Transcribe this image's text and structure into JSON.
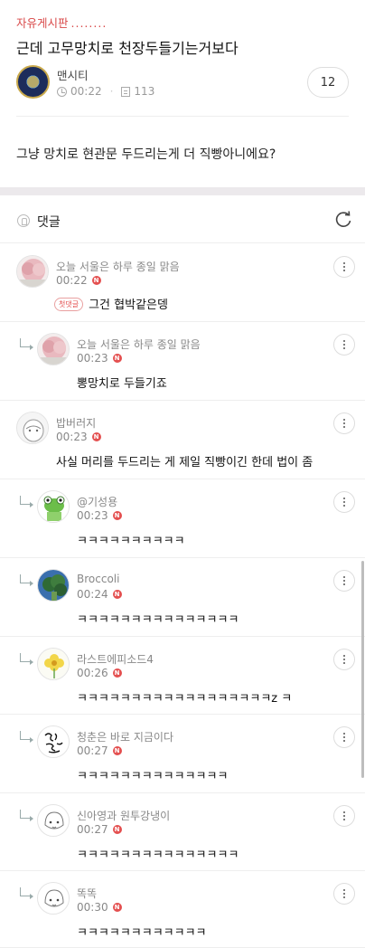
{
  "post": {
    "board": "자유게시판",
    "board_dots": "........",
    "title": "근데 고무망치로 천장두들기는거보다",
    "author": "맨시티",
    "time": "00:22",
    "views": "113",
    "comment_count": "12",
    "body": "그냥 망치로 현관문 두드리는게 더 직빵아니에요?"
  },
  "comments_header": {
    "label": "댓글"
  },
  "badges": {
    "first": "첫댓글",
    "new": "N"
  },
  "comments": [
    {
      "nick": "오늘 서울은 하루 종일 맑음",
      "time": "00:22",
      "text": "그건 협박같은뎅",
      "reply": false,
      "first": true,
      "avatar": "pink-tree-icon"
    },
    {
      "nick": "오늘 서울은 하루 종일 맑음",
      "time": "00:23",
      "text": "뽕망치로 두들기죠",
      "reply": true,
      "avatar": "pink-tree-icon"
    },
    {
      "nick": "밥버러지",
      "time": "00:23",
      "text": "사실 머리를 두드리는 게 제일 직빵이긴 한데 법이 좀",
      "reply": false,
      "avatar": "gray-character-icon"
    },
    {
      "nick": "@기성용",
      "time": "00:23",
      "text": "ㅋㅋㅋㅋㅋㅋㅋㅋㅋㅋ",
      "reply": true,
      "avatar": "frog-icon"
    },
    {
      "nick": "Broccoli",
      "time": "00:24",
      "text": "ㅋㅋㅋㅋㅋㅋㅋㅋㅋㅋㅋㅋㅋㅋㅋ",
      "reply": true,
      "avatar": "broccoli-icon"
    },
    {
      "nick": "라스트에피소드4",
      "time": "00:26",
      "text": "ㅋㅋㅋㅋㅋㅋㅋㅋㅋㅋㅋㅋㅋㅋㅋㅋㅋㅋz ㅋ",
      "reply": true,
      "avatar": "yellow-flower-icon"
    },
    {
      "nick": "청춘은 바로 지금이다",
      "time": "00:27",
      "text": "ㅋㅋㅋㅋㅋㅋㅋㅋㅋㅋㅋㅋㅋㅋ",
      "reply": true,
      "avatar": "calligraphy-icon"
    },
    {
      "nick": "신아영과 원투강냉이",
      "time": "00:27",
      "text": "ㅋㅋㅋㅋㅋㅋㅋㅋㅋㅋㅋㅋㅋㅋㅋ",
      "reply": true,
      "avatar": "sketch-face-icon"
    },
    {
      "nick": "똑똑",
      "time": "00:30",
      "text": "ㅋㅋㅋㅋㅋㅋㅋㅋㅋㅋㅋㅋ",
      "reply": true,
      "avatar": "sketch-face-icon"
    }
  ]
}
